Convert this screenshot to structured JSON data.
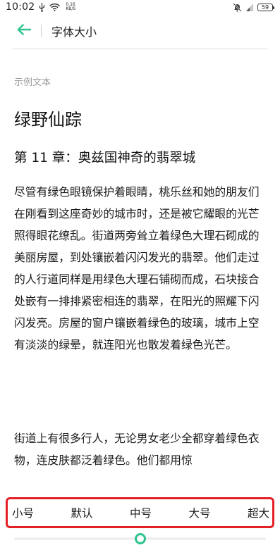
{
  "status_bar": {
    "time": "10:02",
    "net_speed_value": "0.16",
    "net_speed_unit": "KB/S",
    "battery": "59"
  },
  "app_bar": {
    "title": "字体大小",
    "accent_color": "#2fc48e"
  },
  "content": {
    "sample_label": "示例文本",
    "book_title": "绿野仙踪",
    "chapter_title": "第 11 章：奥兹国神奇的翡翠城",
    "paragraphs": [
      "尽管有绿色眼镜保护着眼睛，桃乐丝和她的朋友们在刚看到这座奇妙的城市时，还是被它耀眼的光芒照得眼花缭乱。街道两旁耸立着绿色大理石砌成的美丽房屋，到处镶嵌着闪闪发光的翡翠。他们走过的人行道同样是用绿色大理石铺砌而成，石块接合处嵌有一排排紧密相连的翡翠，在阳光的照耀下闪闪发亮。房屋的窗户镶嵌着绿色的玻璃，城市上空有淡淡的绿晕，就连阳光也散发着绿色光芒。",
      "街道上有很多行人，无论男女老少全都穿着绿色衣物，连皮肤都泛着绿色。他们都用惊"
    ]
  },
  "font_size_options": [
    "小号",
    "默认",
    "中号",
    "大号",
    "超大"
  ],
  "highlight_color": "#e51f26",
  "slider": {
    "selected_option": "中号",
    "position_fraction": 0.5
  }
}
